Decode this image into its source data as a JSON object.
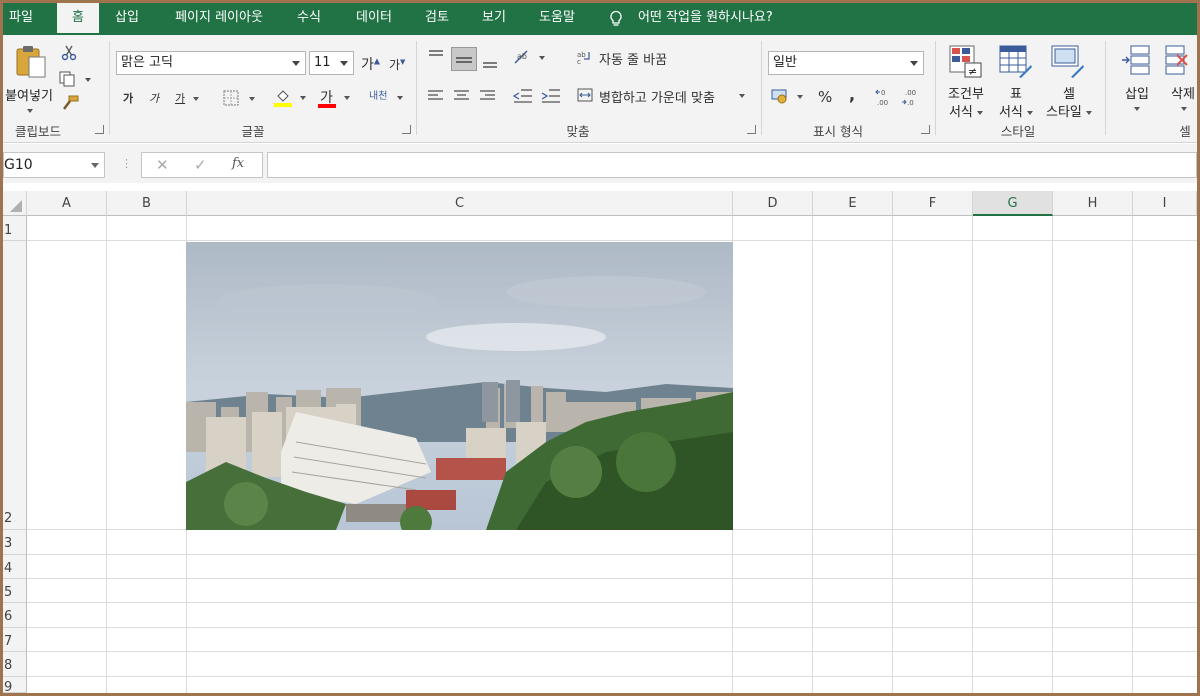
{
  "tabs": [
    {
      "label": "파일",
      "active": false
    },
    {
      "label": "홈",
      "active": true
    },
    {
      "label": "삽입",
      "active": false
    },
    {
      "label": "페이지 레이아웃",
      "active": false
    },
    {
      "label": "수식",
      "active": false
    },
    {
      "label": "데이터",
      "active": false
    },
    {
      "label": "검토",
      "active": false
    },
    {
      "label": "보기",
      "active": false
    },
    {
      "label": "도움말",
      "active": false
    }
  ],
  "tell_me": "어떤 작업을 원하시나요?",
  "ribbon": {
    "clipboard": {
      "paste_label": "붙여넣기",
      "group_label": "클립보드"
    },
    "font": {
      "font_name": "맑은 고딕",
      "font_size": "11",
      "grow_label": "가",
      "shrink_label": "가",
      "bold_label": "가",
      "italic_label": "가",
      "underline_label": "가",
      "font_color_label": "가",
      "phonetic_label": "내천",
      "group_label": "글꼴",
      "fill_color": "#ffff00",
      "font_color": "#ff0000"
    },
    "alignment": {
      "wrap_label": "자동 줄 바꿈",
      "merge_label": "병합하고 가운데 맞춤",
      "group_label": "맞춤"
    },
    "number": {
      "format": "일반",
      "percent_label": "%",
      "comma_label": ",",
      "group_label": "표시 형식"
    },
    "styles": {
      "cond_format_line1": "조건부",
      "cond_format_line2": "서식",
      "table_line1": "표",
      "table_line2": "서식",
      "cell_line1": "셀",
      "cell_line2": "스타일",
      "group_label": "스타일"
    },
    "cells": {
      "insert_label": "삽입",
      "delete_label": "삭제",
      "group_label": "셀"
    }
  },
  "formula_bar": {
    "name_box": "G10",
    "cancel_glyph": "✕",
    "enter_glyph": "✓",
    "fx_label": "fx",
    "formula_value": ""
  },
  "columns": [
    "A",
    "B",
    "C",
    "D",
    "E",
    "F",
    "G",
    "H",
    "I"
  ],
  "selected_column": "G",
  "rows": [
    "1",
    "2",
    "3",
    "4",
    "5",
    "6",
    "7",
    "8",
    "9"
  ],
  "colors": {
    "accent": "#217346",
    "frame": "#a0734f"
  }
}
